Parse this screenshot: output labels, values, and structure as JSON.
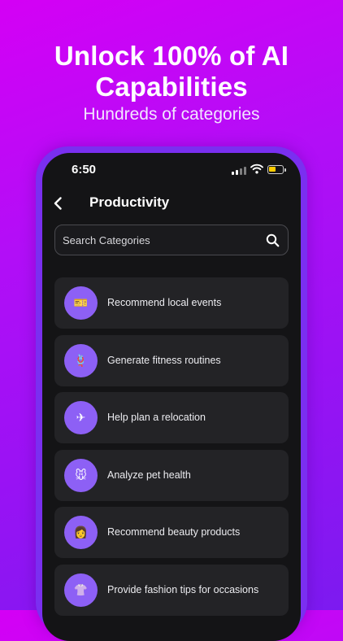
{
  "promo": {
    "headline": "Unlock 100% of AI Capabilities",
    "subheadline": "Hundreds of categories"
  },
  "status_bar": {
    "time": "6:50",
    "battery_color": "#ffcc00",
    "battery_level": 0.5
  },
  "nav": {
    "title": "Productivity",
    "back_icon": "chevron-left-icon"
  },
  "search": {
    "placeholder": "Search Categories",
    "value": "",
    "icon": "search-icon"
  },
  "colors": {
    "accent": "#8d60f5",
    "card_background": "#232326",
    "screen_background": "#141416",
    "frame": "#7a2ff0"
  },
  "categories": [
    {
      "label": "Recommend local events",
      "icon": "🎫",
      "icon_name": "ticket-icon"
    },
    {
      "label": "Generate fitness routines",
      "icon": "🪢",
      "icon_name": "fitness-loop-icon"
    },
    {
      "label": "Help plan a relocation",
      "icon": "✈",
      "icon_name": "airplane-icon"
    },
    {
      "label": "Analyze pet health",
      "icon": "🐭",
      "icon_name": "pet-icon"
    },
    {
      "label": "Recommend beauty products",
      "icon": "👩",
      "icon_name": "beauty-face-icon"
    },
    {
      "label": "Provide fashion tips for occasions",
      "icon": "👚",
      "icon_name": "clothing-icon"
    }
  ]
}
